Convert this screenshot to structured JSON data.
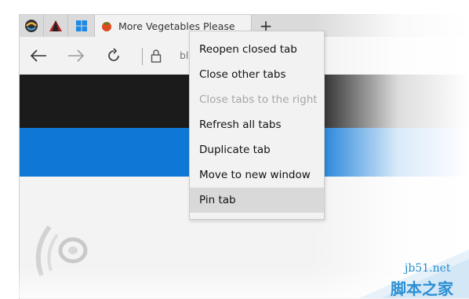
{
  "browser": {
    "tabs": [
      {
        "icon": "edge-swirl-icon"
      },
      {
        "icon": "red-triangle-icon"
      },
      {
        "icon": "windows-logo-icon"
      }
    ],
    "active_tab": {
      "icon": "tomato-icon",
      "title": "More Vegetables Please"
    },
    "new_tab_label": "+",
    "address_partial": "ble"
  },
  "context_menu": {
    "items": [
      {
        "label": "Reopen closed tab",
        "enabled": true
      },
      {
        "label": "Close other tabs",
        "enabled": true
      },
      {
        "label": "Close tabs to the right",
        "enabled": false
      },
      {
        "label": "Refresh all tabs",
        "enabled": true
      },
      {
        "label": "Duplicate tab",
        "enabled": true
      },
      {
        "label": "Move to new window",
        "enabled": true
      },
      {
        "label": "Pin tab",
        "enabled": true,
        "highlighted": true
      }
    ]
  },
  "watermark": {
    "site": "jb51.net",
    "name": "脚本之家"
  },
  "colors": {
    "black_band": "#1b1b1b",
    "blue_band": "#0f78d6",
    "menu_bg": "#f2f2f2",
    "hover": "#d9d9d9"
  }
}
